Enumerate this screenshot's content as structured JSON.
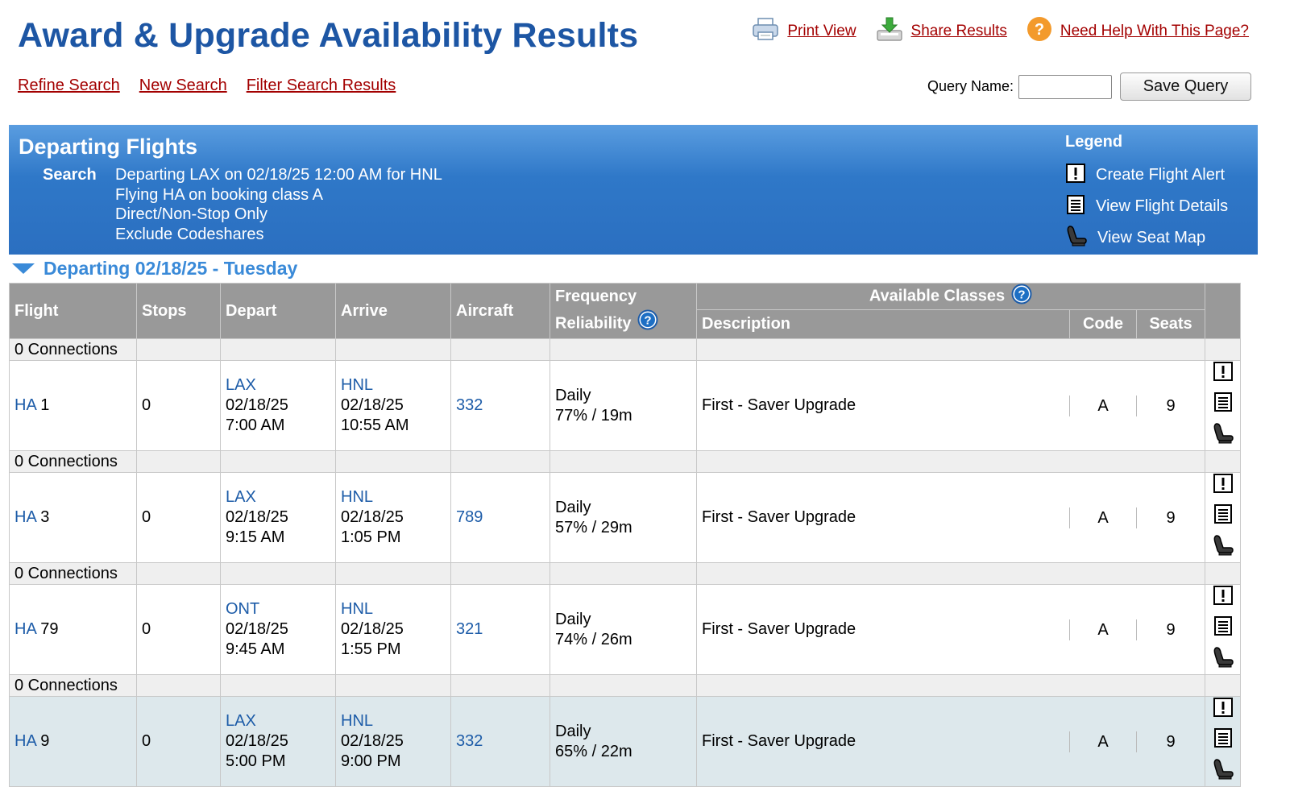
{
  "header": {
    "title": "Award & Upgrade Availability Results",
    "print_view": "Print View",
    "share_results": "Share Results",
    "need_help": "Need Help With This Page?"
  },
  "nav": {
    "refine": "Refine Search",
    "new": "New Search",
    "filter": "Filter Search Results"
  },
  "query": {
    "label": "Query Name:",
    "value": "",
    "save": "Save Query"
  },
  "banner": {
    "title": "Departing Flights",
    "search_label": "Search",
    "search_lines": [
      "Departing LAX on 02/18/25 12:00 AM for HNL",
      "Flying HA on booking class A",
      "Direct/Non-Stop Only",
      "Exclude Codeshares"
    ],
    "legend_title": "Legend",
    "legend": [
      "Create Flight Alert",
      "View Flight Details",
      "View Seat Map"
    ]
  },
  "departing_header": "Departing 02/18/25 - Tuesday",
  "table": {
    "headers": {
      "flight": "Flight",
      "stops": "Stops",
      "depart": "Depart",
      "arrive": "Arrive",
      "aircraft": "Aircraft",
      "freq1": "Frequency",
      "freq2": "Reliability",
      "available": "Available Classes",
      "description": "Description",
      "code": "Code",
      "seats": "Seats"
    },
    "connection_label": "0 Connections",
    "rows": [
      {
        "carrier": "HA",
        "number": "1",
        "stops": "0",
        "dep_airport": "LAX",
        "dep_date": "02/18/25",
        "dep_time": "7:00 AM",
        "arr_airport": "HNL",
        "arr_date": "02/18/25",
        "arr_time": "10:55 AM",
        "aircraft": "332",
        "frequency": "Daily",
        "reliability": "77% / 19m",
        "description": "First - Saver Upgrade",
        "code": "A",
        "seats": "9"
      },
      {
        "carrier": "HA",
        "number": "3",
        "stops": "0",
        "dep_airport": "LAX",
        "dep_date": "02/18/25",
        "dep_time": "9:15 AM",
        "arr_airport": "HNL",
        "arr_date": "02/18/25",
        "arr_time": "1:05 PM",
        "aircraft": "789",
        "frequency": "Daily",
        "reliability": "57% / 29m",
        "description": "First - Saver Upgrade",
        "code": "A",
        "seats": "9"
      },
      {
        "carrier": "HA",
        "number": "79",
        "stops": "0",
        "dep_airport": "ONT",
        "dep_date": "02/18/25",
        "dep_time": "9:45 AM",
        "arr_airport": "HNL",
        "arr_date": "02/18/25",
        "arr_time": "1:55 PM",
        "aircraft": "321",
        "frequency": "Daily",
        "reliability": "74% / 26m",
        "description": "First - Saver Upgrade",
        "code": "A",
        "seats": "9"
      },
      {
        "carrier": "HA",
        "number": "9",
        "stops": "0",
        "dep_airport": "LAX",
        "dep_date": "02/18/25",
        "dep_time": "5:00 PM",
        "arr_airport": "HNL",
        "arr_date": "02/18/25",
        "arr_time": "9:00 PM",
        "aircraft": "332",
        "frequency": "Daily",
        "reliability": "65% / 22m",
        "description": "First - Saver Upgrade",
        "code": "A",
        "seats": "9"
      }
    ]
  }
}
